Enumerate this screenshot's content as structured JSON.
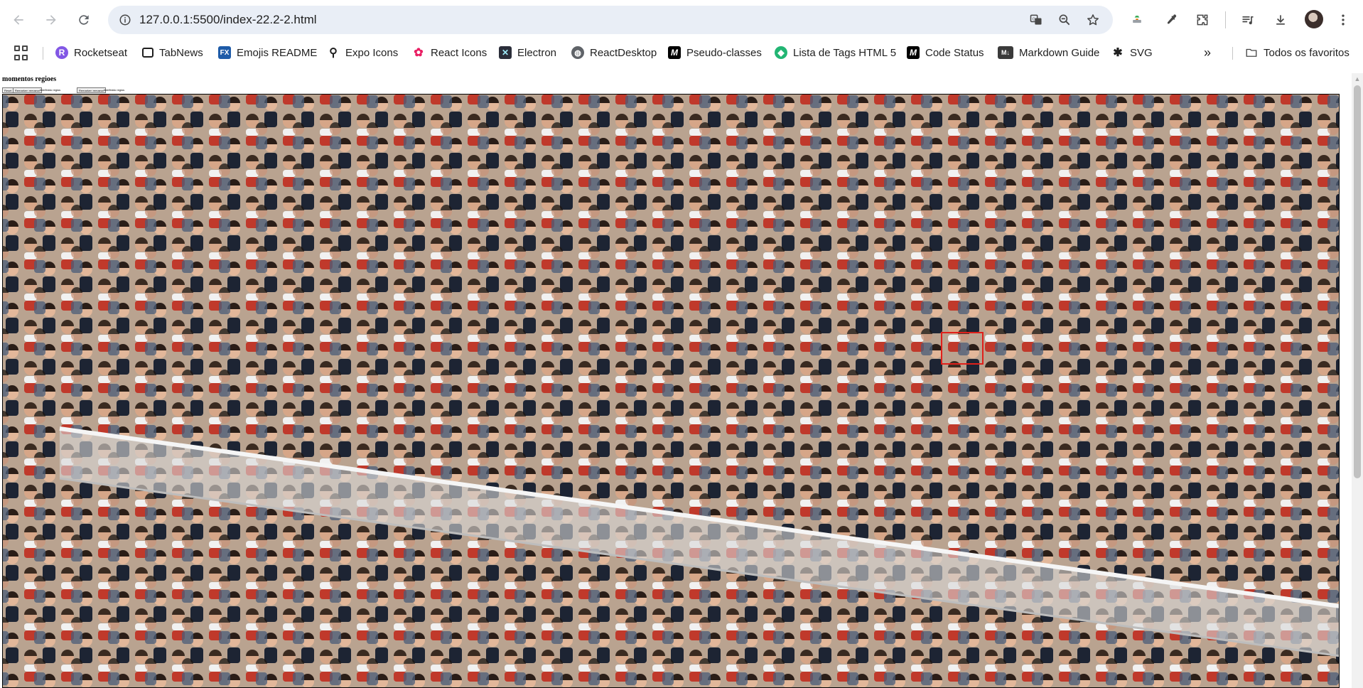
{
  "browser": {
    "url": "127.0.0.1:5500/index-22.2-2.html"
  },
  "bookmarks": {
    "items": [
      {
        "label": "Rocketseat",
        "color": "#8257e5",
        "glyph": "R"
      },
      {
        "label": "TabNews",
        "color": "#1f1f1f",
        "glyph": "▭"
      },
      {
        "label": "Emojis README",
        "color": "#1e5ba8",
        "glyph": "FX"
      },
      {
        "label": "Expo Icons",
        "color": "#1f1f1f",
        "glyph": "⚲"
      },
      {
        "label": "React Icons",
        "color": "#e91e63",
        "glyph": "✿"
      },
      {
        "label": "Electron",
        "color": "#2b2e3a",
        "glyph": "⚛"
      },
      {
        "label": "ReactDesktop",
        "color": "#5f6368",
        "glyph": "◍"
      },
      {
        "label": "Pseudo-classes",
        "color": "#000000",
        "glyph": "M"
      },
      {
        "label": "Lista de Tags HTML 5",
        "color": "#22b573",
        "glyph": "◆"
      },
      {
        "label": "Code Status",
        "color": "#000000",
        "glyph": "M"
      },
      {
        "label": "Markdown Guide",
        "color": "#3a3a3a",
        "glyph": "M↓"
      },
      {
        "label": "SVG",
        "color": "#1f1f1f",
        "glyph": "✱"
      }
    ],
    "overflow": "»",
    "all_bookmarks": "Todos os favoritos"
  },
  "page": {
    "title": "momentos regioes",
    "buttons": [
      "Reset",
      "Remarken remaeon",
      "Remarken remaeon"
    ],
    "texts": [
      "indefinido regios",
      "indefinido regios"
    ]
  },
  "colors": {
    "accent_box": "#e0201a"
  }
}
